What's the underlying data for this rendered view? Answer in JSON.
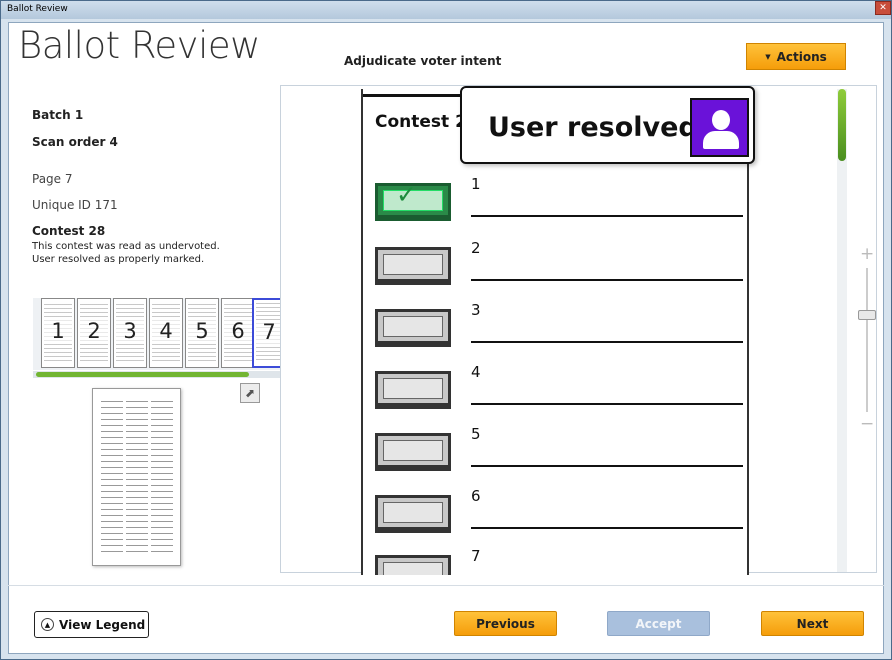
{
  "window": {
    "title": "Ballot Review",
    "close_glyph": "✕"
  },
  "header": {
    "app_title": "Ballot Review",
    "subtitle": "Adjudicate voter intent",
    "actions_label": "Actions",
    "actions_icon": "chevron-down-icon"
  },
  "info": {
    "batch": "Batch  1",
    "scan_order": "Scan order  4",
    "page": "Page  7",
    "unique_id": "Unique ID 171",
    "contest": "Contest 28",
    "message_line1": "This contest was read as undervoted.",
    "message_line2": "User resolved as properly marked."
  },
  "thumbnails": [
    {
      "label": "1"
    },
    {
      "label": "2"
    },
    {
      "label": "3"
    },
    {
      "label": "4"
    },
    {
      "label": "5"
    },
    {
      "label": "6"
    },
    {
      "label": "7",
      "selected": true
    }
  ],
  "ballot": {
    "contest_heading": "Contest 2",
    "options": [
      {
        "label": "1",
        "marked": true
      },
      {
        "label": "2",
        "marked": false
      },
      {
        "label": "3",
        "marked": false
      },
      {
        "label": "4",
        "marked": false
      },
      {
        "label": "5",
        "marked": false
      },
      {
        "label": "6",
        "marked": false
      },
      {
        "label": "7",
        "marked": false
      }
    ]
  },
  "resolution_popup": {
    "text": "User resolved",
    "icon": "user-icon",
    "badge_color": "#6a12d9"
  },
  "footer": {
    "legend_label": "View Legend",
    "previous_label": "Previous",
    "accept_label": "Accept",
    "next_label": "Next"
  },
  "colors": {
    "accent_orange": "#f5a511",
    "disabled_blue": "#a9c0dd",
    "scroll_green": "#72b532"
  }
}
